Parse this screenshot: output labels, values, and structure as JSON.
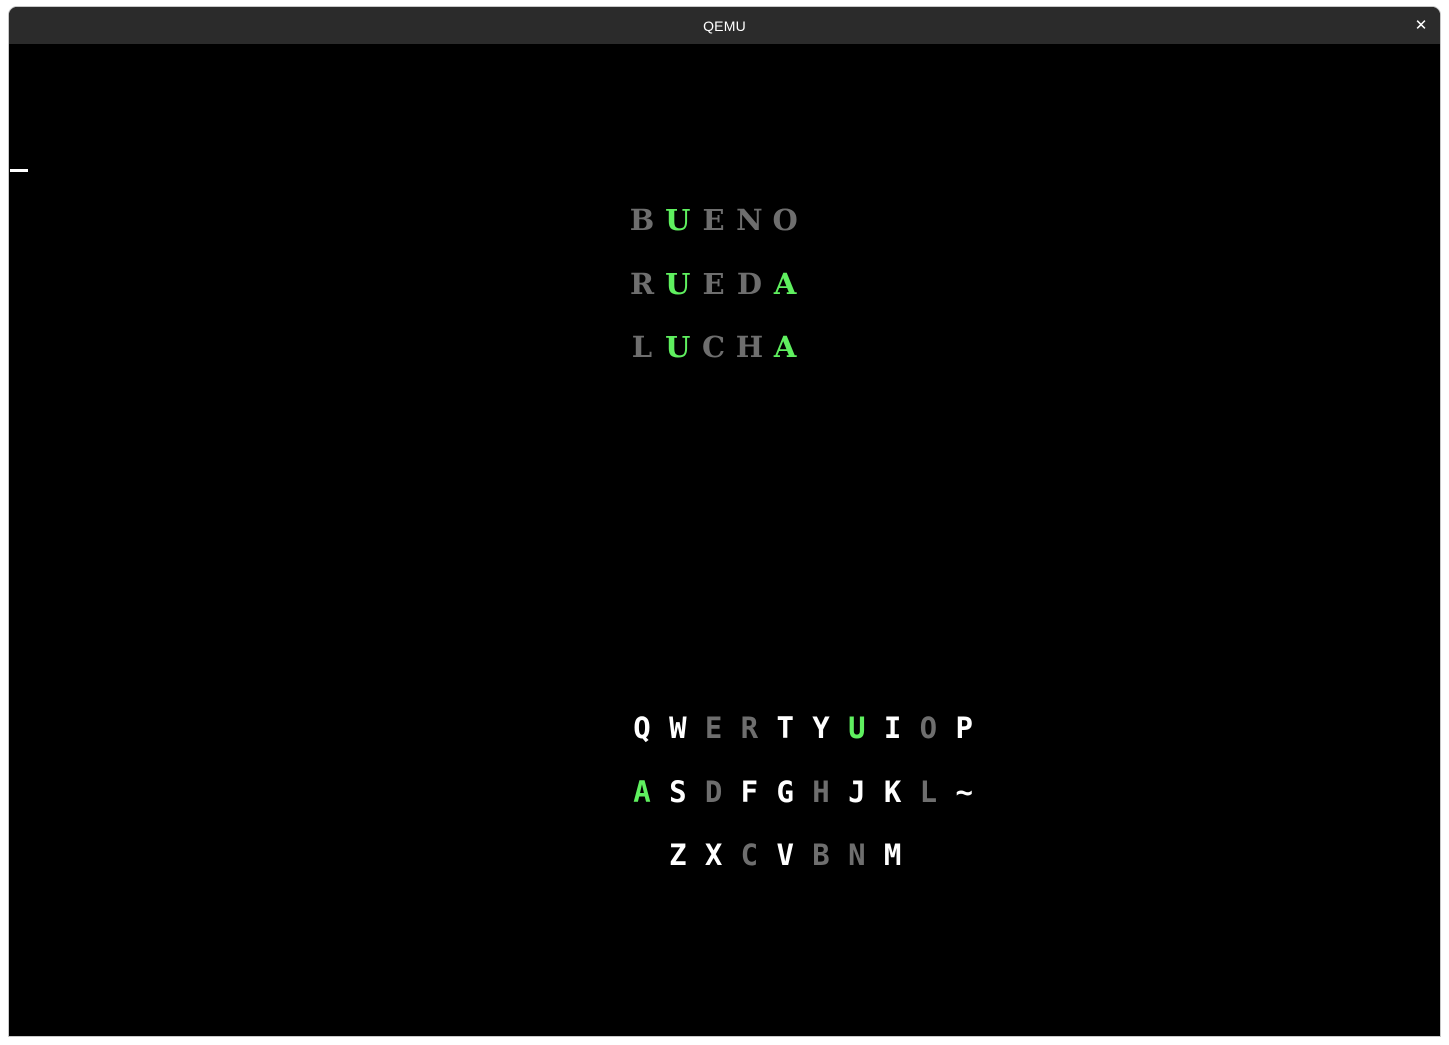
{
  "window": {
    "title": "QEMU",
    "close_glyph": "✕"
  },
  "colors": {
    "absent": "#6e6e6e",
    "correct": "#5ff05f",
    "unused": "#ffffff",
    "background": "#000000",
    "titlebar": "#2b2b2b"
  },
  "board": {
    "guesses": [
      {
        "word": "BUENO",
        "letters": [
          {
            "char": "B",
            "state": "absent"
          },
          {
            "char": "U",
            "state": "correct"
          },
          {
            "char": "E",
            "state": "absent"
          },
          {
            "char": "N",
            "state": "absent"
          },
          {
            "char": "O",
            "state": "absent"
          }
        ]
      },
      {
        "word": "RUEDA",
        "letters": [
          {
            "char": "R",
            "state": "absent"
          },
          {
            "char": "U",
            "state": "correct"
          },
          {
            "char": "E",
            "state": "absent"
          },
          {
            "char": "D",
            "state": "absent"
          },
          {
            "char": "A",
            "state": "correct"
          }
        ]
      },
      {
        "word": "LUCHA",
        "letters": [
          {
            "char": "L",
            "state": "absent"
          },
          {
            "char": "U",
            "state": "correct"
          },
          {
            "char": "C",
            "state": "absent"
          },
          {
            "char": "H",
            "state": "absent"
          },
          {
            "char": "A",
            "state": "correct"
          }
        ]
      }
    ]
  },
  "keyboard": {
    "rows": [
      [
        {
          "char": "Q",
          "state": "unused"
        },
        {
          "char": "W",
          "state": "unused"
        },
        {
          "char": "E",
          "state": "absent"
        },
        {
          "char": "R",
          "state": "absent"
        },
        {
          "char": "T",
          "state": "unused"
        },
        {
          "char": "Y",
          "state": "unused"
        },
        {
          "char": "U",
          "state": "correct"
        },
        {
          "char": "I",
          "state": "unused"
        },
        {
          "char": "O",
          "state": "absent"
        },
        {
          "char": "P",
          "state": "unused"
        }
      ],
      [
        {
          "char": "A",
          "state": "correct"
        },
        {
          "char": "S",
          "state": "unused"
        },
        {
          "char": "D",
          "state": "absent"
        },
        {
          "char": "F",
          "state": "unused"
        },
        {
          "char": "G",
          "state": "unused"
        },
        {
          "char": "H",
          "state": "absent"
        },
        {
          "char": "J",
          "state": "unused"
        },
        {
          "char": "K",
          "state": "unused"
        },
        {
          "char": "L",
          "state": "absent"
        },
        {
          "char": "~",
          "state": "unused"
        }
      ],
      [
        {
          "char": "Z",
          "state": "unused"
        },
        {
          "char": "X",
          "state": "unused"
        },
        {
          "char": "C",
          "state": "absent"
        },
        {
          "char": "V",
          "state": "unused"
        },
        {
          "char": "B",
          "state": "absent"
        },
        {
          "char": "N",
          "state": "absent"
        },
        {
          "char": "M",
          "state": "unused"
        }
      ]
    ]
  }
}
